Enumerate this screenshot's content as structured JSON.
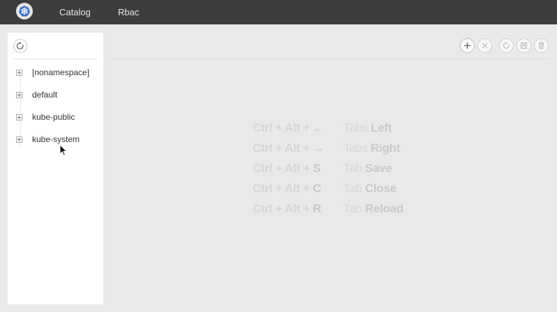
{
  "nav": {
    "logo_icon": "kubernetes-helm-icon",
    "items": [
      {
        "label": "Catalog"
      },
      {
        "label": "Rbac"
      }
    ]
  },
  "sidebar": {
    "refresh_icon": "refresh-icon",
    "tree": [
      {
        "label": "[nonamespace]"
      },
      {
        "label": "default"
      },
      {
        "label": "kube-public"
      },
      {
        "label": "kube-system"
      }
    ]
  },
  "toolbar": {
    "buttons": [
      "plus-icon",
      "close-icon",
      "reload-icon",
      "save-icon",
      "delete-icon"
    ]
  },
  "shortcuts": [
    {
      "keys": "Ctrl + Alt +",
      "key": "←",
      "scope": "Tabs",
      "action": "Left"
    },
    {
      "keys": "Ctrl + Alt +",
      "key": "→",
      "scope": "Tabs",
      "action": "Right"
    },
    {
      "keys": "Ctrl + Alt +",
      "key": "S",
      "scope": "Tab",
      "action": "Save"
    },
    {
      "keys": "Ctrl + Alt +",
      "key": "C",
      "scope": "Tab",
      "action": "Close"
    },
    {
      "keys": "Ctrl + Alt +",
      "key": "R",
      "scope": "Tab",
      "action": "Reload"
    }
  ],
  "colors": {
    "topbar": "#3d3d3d",
    "background": "#e9e9e9",
    "sidebar": "#ffffff",
    "logo_wheel": "#3a6ec5"
  }
}
